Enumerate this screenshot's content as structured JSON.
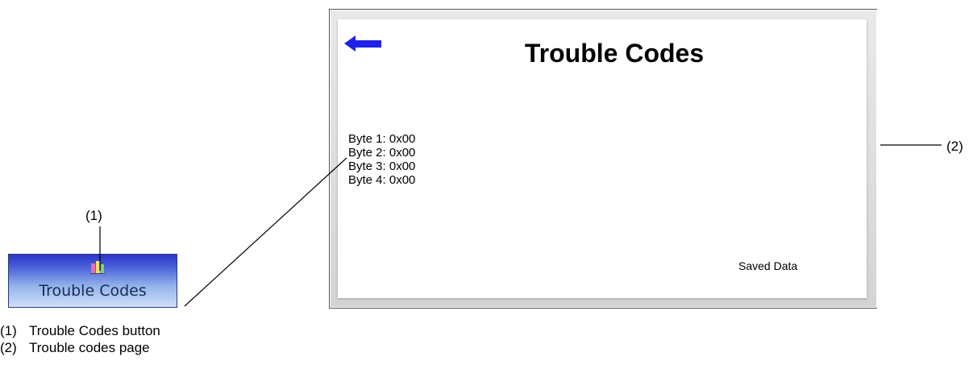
{
  "callouts": {
    "button_marker": "(1)",
    "page_marker": "(2)"
  },
  "button": {
    "label": "Trouble Codes",
    "icon": "trouble-codes-bars-icon"
  },
  "screen": {
    "title": "Trouble Codes",
    "back_icon": "back-arrow-icon",
    "bytes": [
      {
        "label": "Byte 1:",
        "value": "0x00"
      },
      {
        "label": "Byte 2:",
        "value": "0x00"
      },
      {
        "label": "Byte 3:",
        "value": "0x00"
      },
      {
        "label": "Byte 4:",
        "value": "0x00"
      }
    ],
    "saved_data_label": "Saved Data"
  },
  "legend": [
    {
      "num": "(1)",
      "text": "Trouble Codes button"
    },
    {
      "num": "(2)",
      "text": "Trouble codes page"
    }
  ],
  "colors": {
    "button_gradient_top": "#2d35c9",
    "button_gradient_bottom": "#cfe0f8",
    "back_arrow": "#1f22e8"
  }
}
